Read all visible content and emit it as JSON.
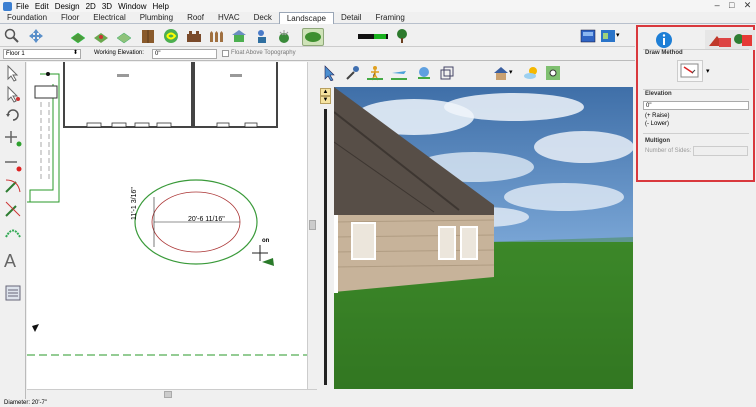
{
  "menu": [
    "File",
    "Edit",
    "Design",
    "2D",
    "3D",
    "Window",
    "Help"
  ],
  "window_controls": [
    "–",
    "□",
    "✕"
  ],
  "tabs": [
    "Foundation",
    "Floor",
    "Electrical",
    "Plumbing",
    "Roof",
    "HVAC",
    "Deck",
    "Landscape",
    "Detail",
    "Framing"
  ],
  "active_tab": "Landscape",
  "floorbar": {
    "floor": "Floor 1",
    "elevation_label": "Working Elevation:",
    "elevation_value": "0\"",
    "float_label": "Float Above Topography"
  },
  "plan": {
    "dim_horizontal": "20'-6 11/16\"",
    "dim_vertical": "11'-1 3/16\"",
    "on_label": "on"
  },
  "right_panel": {
    "draw_method_label": "Draw Method",
    "elevation_label": "Elevation",
    "elevation_value": "0\"",
    "raise_label": "(+ Raise)",
    "lower_label": "(- Lower)",
    "multigon_label": "Multigon",
    "sides_placeholder": "Number of Sides:"
  },
  "status": "Diameter:  20'-7\"",
  "colors": {
    "highlight": "#d9383d",
    "info": "#1e7fd6",
    "green": "#3a8a3a"
  }
}
